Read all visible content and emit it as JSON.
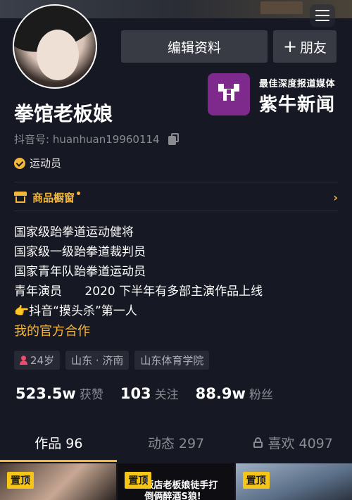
{
  "header": {
    "menu_icon": "hamburger-icon"
  },
  "profile": {
    "name": "拳馆老板娘",
    "douyin_id": "抖音号: huanhuan19960114",
    "verification": "运动员",
    "edit_button": "编辑资料",
    "add_friend_button": "朋友",
    "add_friend_plus": "+"
  },
  "watermark": {
    "tagline": "最佳深度报道媒体",
    "brand": "紫牛新闻"
  },
  "shop": {
    "label": "商品橱窗",
    "arrow": "›"
  },
  "bio": {
    "lines": [
      "国家级跆拳道运动健将",
      "国家级一级跆拳道裁判员",
      "国家青年队跆拳道运动员",
      "青年演员      2020 下半年有多部主演作品上线"
    ],
    "hand_emoji": "👉",
    "last_line": "抖音“摸头杀”第一人",
    "cooperation_link": "我的官方合作"
  },
  "tags": {
    "age": "24岁",
    "location": "山东 · 济南",
    "school": "山东体育学院"
  },
  "stats": {
    "likes_num": "523.5w",
    "likes_label": "获赞",
    "following_num": "103",
    "following_label": "关注",
    "fans_num": "88.9w",
    "fans_label": "粉丝"
  },
  "tabs": {
    "works": "作品 96",
    "dynamics": "动态 297",
    "likes": "喜欢 4097"
  },
  "grid": {
    "pin_label": "置顶",
    "item2_text": "飯店老板娘徒手打\n倒俩醉酒S狼!"
  },
  "colors": {
    "background": "#161823",
    "accent": "#f5b73b",
    "button": "#393b44",
    "watermark_logo": "#7d2a8c"
  }
}
